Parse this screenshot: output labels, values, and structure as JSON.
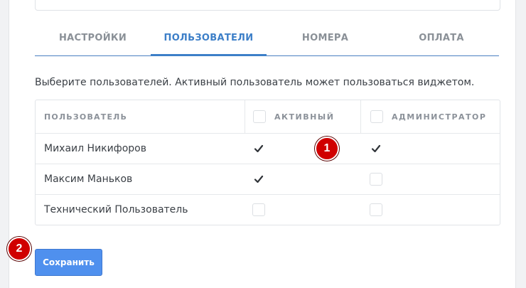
{
  "tabs": [
    {
      "label": "НАСТРОЙКИ",
      "active": false
    },
    {
      "label": "ПОЛЬЗОВАТЕЛИ",
      "active": true
    },
    {
      "label": "НОМЕРА",
      "active": false
    },
    {
      "label": "ОПЛАТА",
      "active": false
    }
  ],
  "description": "Выберите пользователей. Активный пользователь может пользоваться виджетом.",
  "table": {
    "headers": {
      "user": "ПОЛЬЗОВАТЕЛЬ",
      "active": "АКТИВНЫЙ",
      "admin": "АДМИНИСТРАТОР"
    },
    "rows": [
      {
        "name": "Михаил Никифоров",
        "active": true,
        "admin": true
      },
      {
        "name": "Максим Маньков",
        "active": true,
        "admin": false
      },
      {
        "name": "Технический Пользователь",
        "active": false,
        "admin": false
      }
    ]
  },
  "annotations": [
    "1",
    "2"
  ],
  "save_button": "Сохранить",
  "colors": {
    "accent": "#3d7fc8",
    "button": "#4f90ee",
    "badge": "#d00000"
  }
}
